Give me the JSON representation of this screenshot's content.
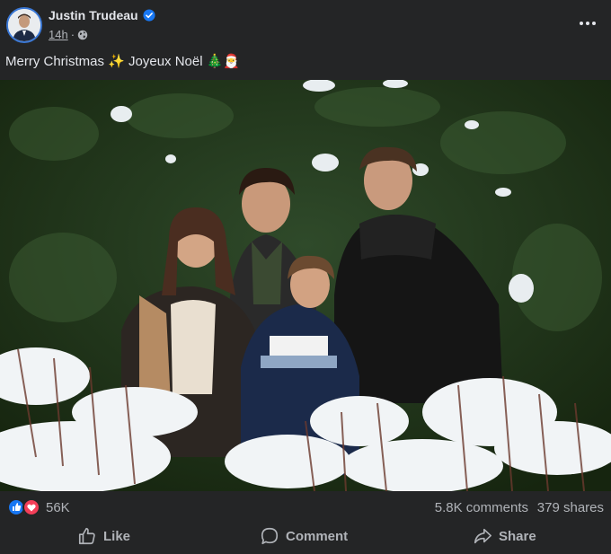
{
  "post": {
    "author": "Justin Trudeau",
    "time": "14h",
    "separator": "·",
    "audience_icon": "globe-icon",
    "caption": "Merry Christmas ✨ Joyeux Noël 🎄🎅",
    "verified_icon": "verified-badge-icon",
    "more_icon": "more-options-icon"
  },
  "stats": {
    "reactions": "56K",
    "comments": "5.8K comments",
    "shares": "379 shares"
  },
  "actions": {
    "like": "Like",
    "comment": "Comment",
    "share": "Share"
  },
  "colors": {
    "background": "#242526",
    "text": "#e4e6eb",
    "secondary_text": "#b0b3b8",
    "like_blue": "#1877f2",
    "love_red": "#f33e58"
  }
}
